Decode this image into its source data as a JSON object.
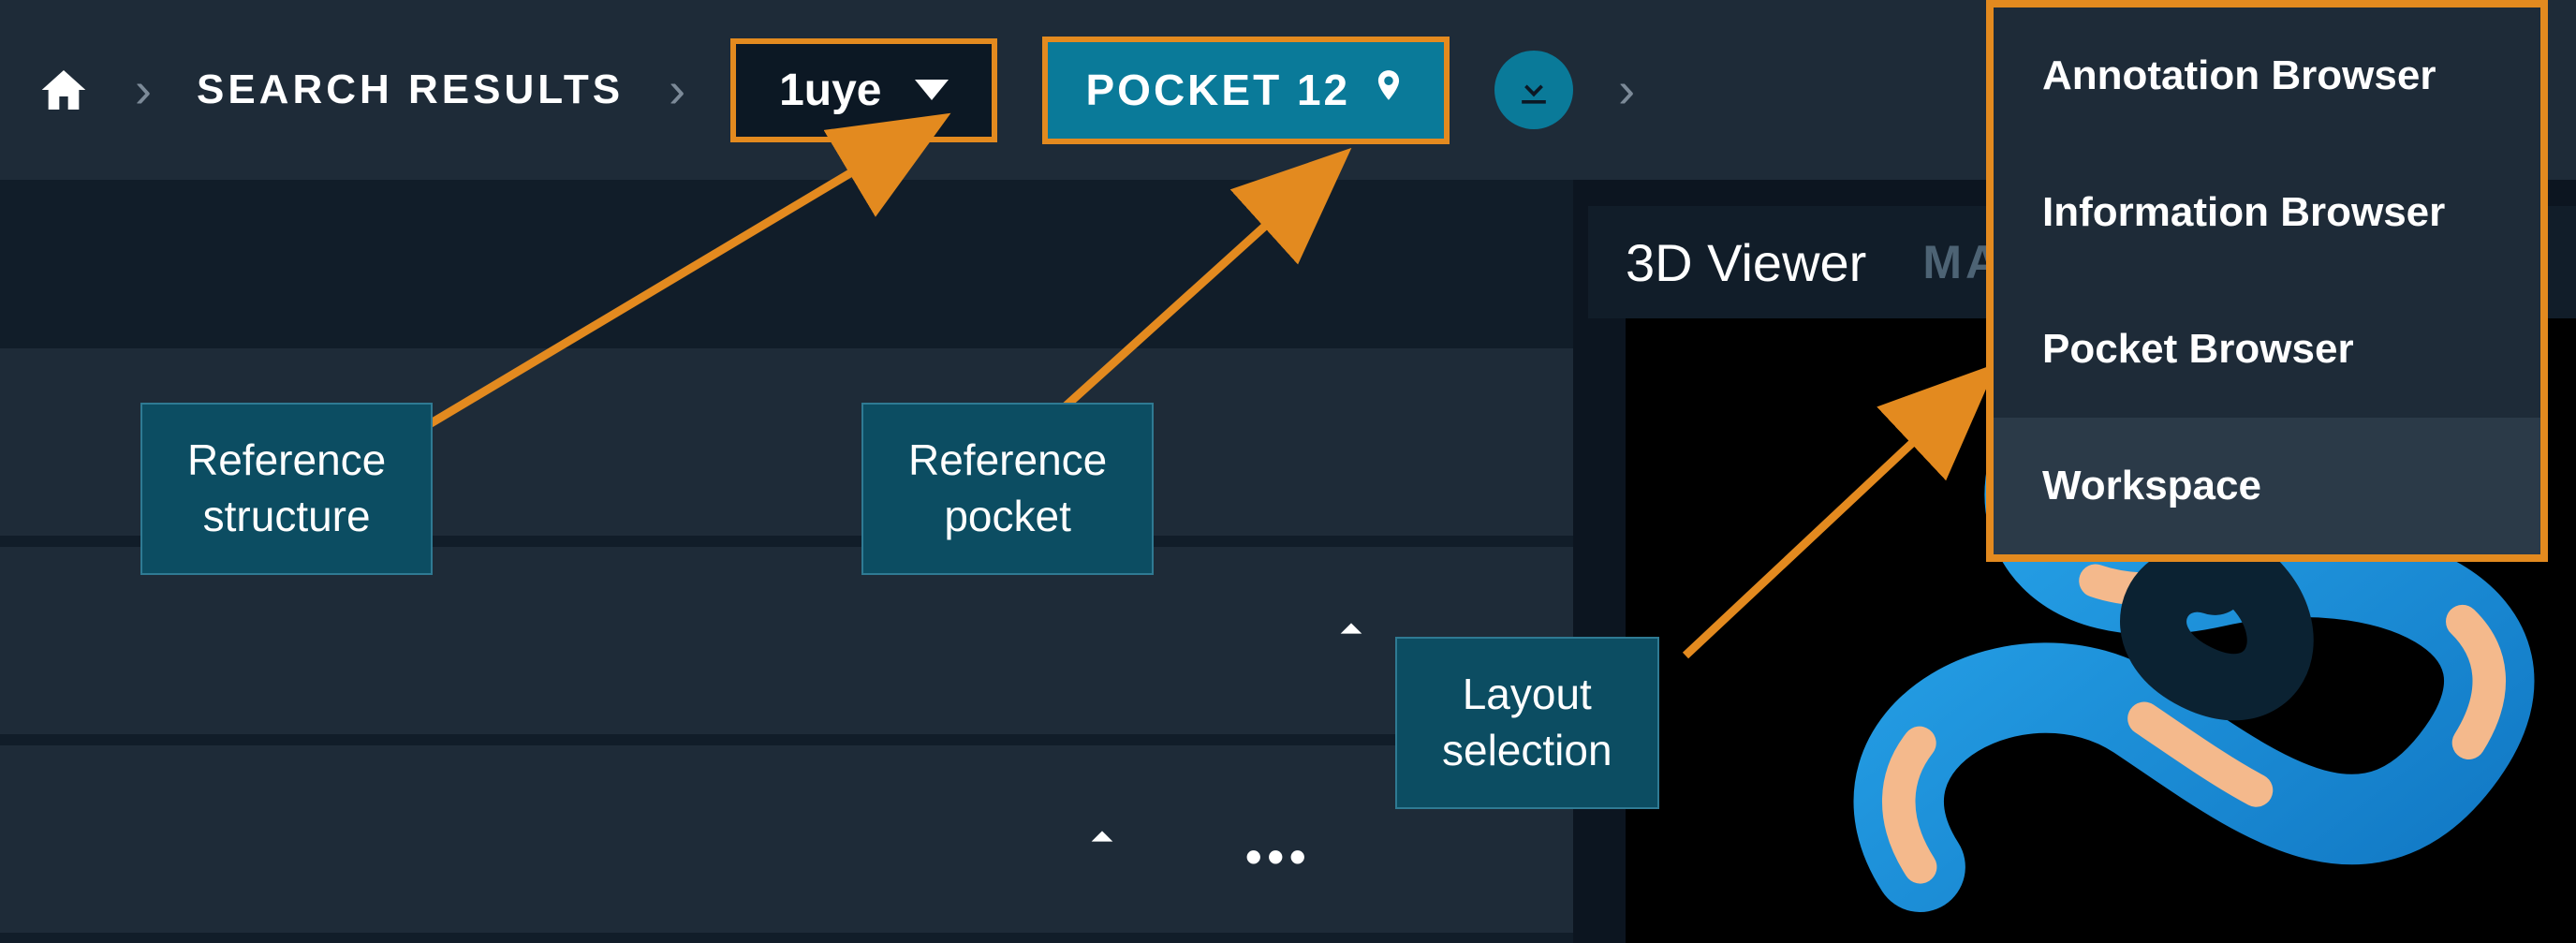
{
  "breadcrumb": {
    "search_results": "SEARCH RESULTS",
    "structure_id": "1uye",
    "pocket_label": "POCKET 12"
  },
  "viewer": {
    "tab_active": "3D Viewer",
    "tab_secondary": "MA"
  },
  "layout_menu": {
    "items": [
      {
        "label": "Annotation Browser"
      },
      {
        "label": "Information Browser"
      },
      {
        "label": "Pocket Browser"
      },
      {
        "label": "Workspace"
      }
    ],
    "selected_index": 3
  },
  "callouts": {
    "reference_structure": "Reference\nstructure",
    "reference_pocket": "Reference\npocket",
    "layout_selection": "Layout\nselection"
  },
  "colors": {
    "highlight_border": "#e38a1f",
    "accent": "#0a7a99",
    "bg_dark": "#0c1520",
    "bg_panel": "#1e2b38",
    "callout_bg": "#0c4d62"
  }
}
